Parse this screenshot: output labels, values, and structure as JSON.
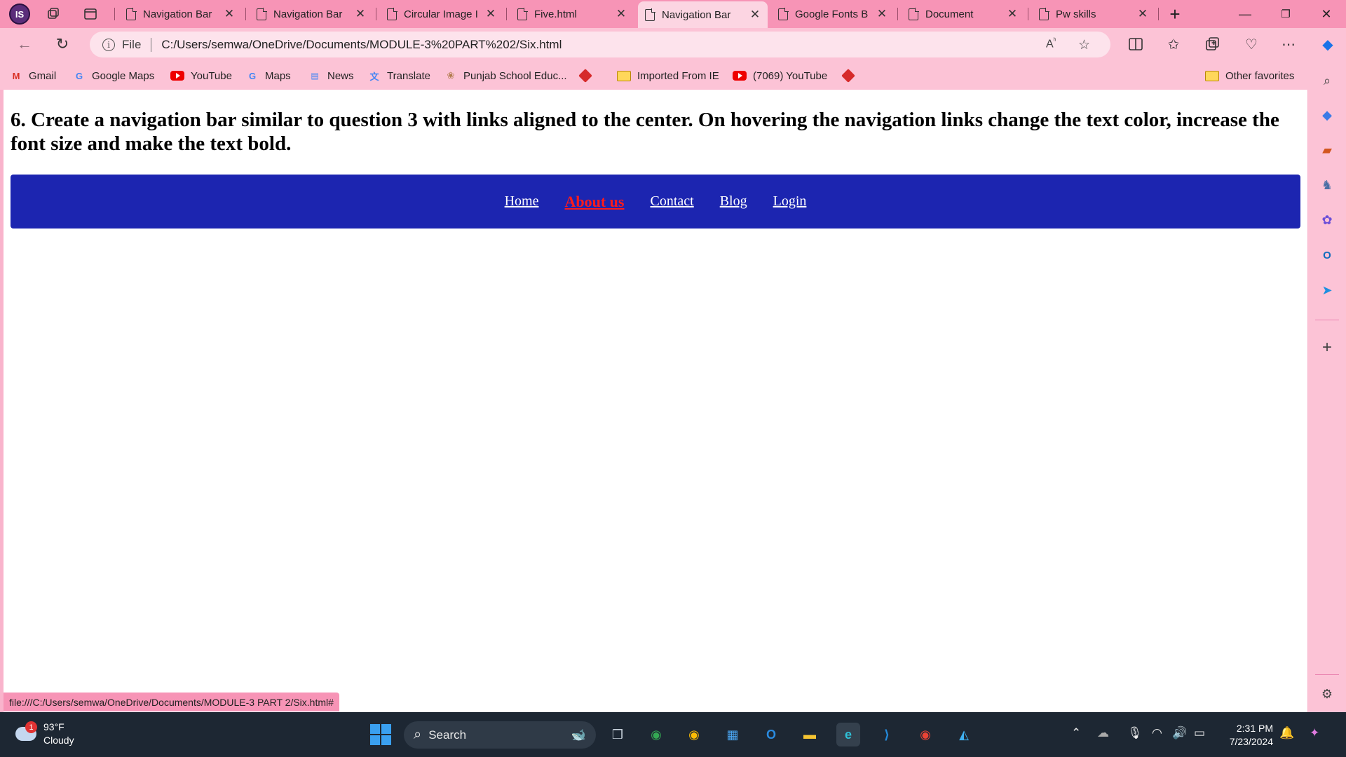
{
  "browser": {
    "profile_initials": "IS",
    "tabs": [
      {
        "title": "Navigation Bar",
        "active": false
      },
      {
        "title": "Navigation Bar",
        "active": false
      },
      {
        "title": "Circular Image I",
        "active": false
      },
      {
        "title": "Five.html",
        "active": false
      },
      {
        "title": "Navigation Bar",
        "active": true
      },
      {
        "title": "Google Fonts B",
        "active": false
      },
      {
        "title": "Document",
        "active": false
      },
      {
        "title": "Pw skills",
        "active": false
      }
    ],
    "address": {
      "scheme_label": "File",
      "url": "C:/Users/semwa/OneDrive/Documents/MODULE-3%20PART%202/Six.html"
    },
    "favorites": [
      {
        "label": "Gmail",
        "icon": "gmail-icon"
      },
      {
        "label": "Google Maps",
        "icon": "google-icon"
      },
      {
        "label": "YouTube",
        "icon": "youtube-icon"
      },
      {
        "label": "Maps",
        "icon": "google-icon"
      },
      {
        "label": "News",
        "icon": "news-icon"
      },
      {
        "label": "Translate",
        "icon": "translate-icon"
      },
      {
        "label": "Punjab School Educ...",
        "icon": "school-icon"
      },
      {
        "label": "",
        "icon": "diamond-icon"
      },
      {
        "label": "Imported From IE",
        "icon": "folder-icon"
      },
      {
        "label": "(7069) YouTube",
        "icon": "youtube-icon"
      },
      {
        "label": "",
        "icon": "diamond-icon"
      }
    ],
    "other_favorites": "Other favorites",
    "status_url": "file:///C:/Users/semwa/OneDrive/Documents/MODULE-3 PART 2/Six.html#"
  },
  "page": {
    "question": "6. Create a navigation bar similar to question 3 with links aligned to the center. On hovering the navigation links change the text color, increase the font size and make the text bold.",
    "nav_links": [
      {
        "label": "Home",
        "hovered": false
      },
      {
        "label": "About us",
        "hovered": true
      },
      {
        "label": "Contact",
        "hovered": false
      },
      {
        "label": "Blog",
        "hovered": false
      },
      {
        "label": "Login",
        "hovered": false
      }
    ],
    "navbar_color": "#1c25b0",
    "hover_color": "#ff1b1b"
  },
  "taskbar": {
    "weather_temp": "93°F",
    "weather_desc": "Cloudy",
    "weather_badge": "1",
    "search_label": "Search",
    "time": "2:31 PM",
    "date": "7/23/2024"
  }
}
